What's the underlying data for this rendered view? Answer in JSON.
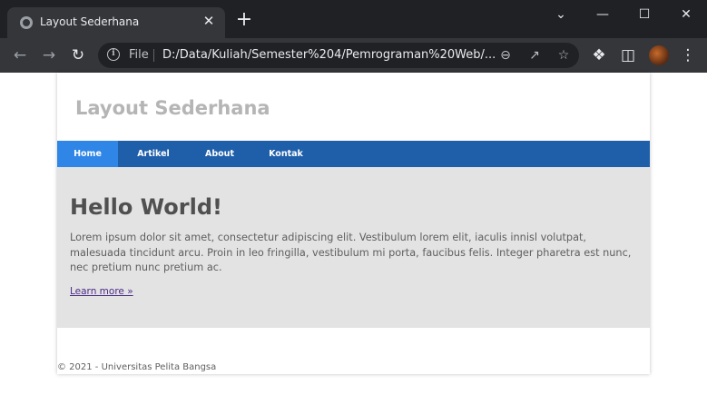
{
  "browser": {
    "tab_title": "Layout Sederhana",
    "tab_close": "✕",
    "new_tab": "+",
    "window": {
      "minimize": "—",
      "maximize": "☐",
      "close": "✕",
      "dropdown": "⌄"
    },
    "omnibox": {
      "scheme_label": "File",
      "url": "D:/Data/Kuliah/Semester%204/Pemrograman%20Web/..."
    },
    "icons": {
      "back": "back-arrow-icon",
      "forward": "forward-arrow-icon",
      "reload": "reload-icon",
      "info": "info-icon",
      "zoom": "zoom-out-icon",
      "share": "share-icon",
      "bookmark": "star-icon",
      "extensions": "puzzle-icon",
      "sidepanel": "side-panel-icon",
      "menu": "kebab-menu-icon"
    }
  },
  "site": {
    "title": "Layout Sederhana",
    "nav": [
      {
        "label": "Home",
        "active": true
      },
      {
        "label": "Artikel",
        "active": false
      },
      {
        "label": "About",
        "active": false
      },
      {
        "label": "Kontak",
        "active": false
      }
    ],
    "hero": {
      "heading": "Hello World!",
      "body": "Lorem ipsum dolor sit amet, consectetur adipiscing elit. Vestibulum lorem elit, iaculis innisl volutpat, malesuada tincidunt arcu. Proin in leo fringilla, vestibulum mi porta, faucibus felis. Integer pharetra est nunc, nec pretium nunc pretium ac.",
      "link": "Learn more »"
    },
    "footer": "© 2021 - Universitas Pelita Bangsa"
  },
  "colors": {
    "nav_bg": "#1f5faa",
    "nav_active": "#2f86e6",
    "hero_bg": "#e3e3e3",
    "title_color": "#b5b5b5"
  }
}
